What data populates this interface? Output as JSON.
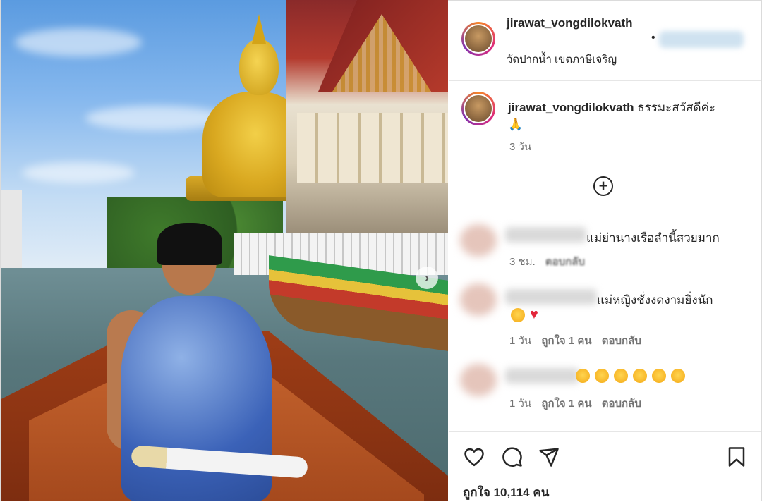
{
  "post": {
    "username": "jirawat_vongdilokvath",
    "location": "วัดปากน้ำ เขตภาษีเจริญ",
    "caption_user": "jirawat_vongdilokvath",
    "caption_text": "ธรรมะสวัสดีค่ะ",
    "caption_time": "3 วัน",
    "likes_text": "ถูกใจ 10,114 คน"
  },
  "header": {
    "dot": "•"
  },
  "comments": [
    {
      "text": "แม่ย่านางเรือลำนี้สวยมาก",
      "time": "3 ชม.",
      "reply": "ตอบกลับ"
    },
    {
      "text": "แม่หญิงชั่งงดงามยิ่งนัก",
      "time": "1 วัน",
      "likes": "ถูกใจ 1 คน",
      "reply": "ตอบกลับ"
    },
    {
      "text": "",
      "time": "1 วัน",
      "likes": "ถูกใจ 1 คน",
      "reply": "ตอบกลับ"
    }
  ],
  "icons": {
    "next": "chevron-right-icon",
    "load_more": "plus-circle-icon",
    "like": "heart-icon",
    "comment": "comment-icon",
    "share": "paper-plane-icon",
    "save": "bookmark-icon"
  }
}
